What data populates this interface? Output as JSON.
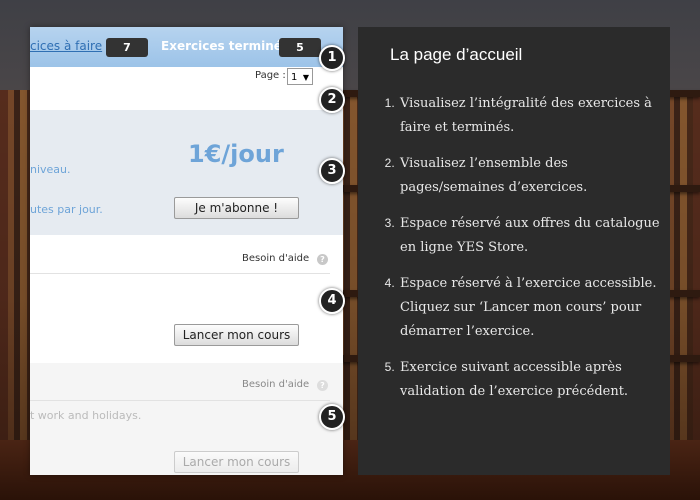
{
  "app": {
    "topbar": {
      "todo_label": "cices à faire",
      "todo_count": "7",
      "done_label": "Exercices terminés",
      "done_count": "5"
    },
    "pagination": {
      "label": "Page :",
      "selected": "1"
    },
    "offer": {
      "price": "1€/jour",
      "line1": "niveau.",
      "line2": "utes par jour.",
      "subscribe_button": "Je m'abonne !"
    },
    "exercise_current": {
      "help_label": "Besoin d'aide",
      "help_icon": "question-icon",
      "start_button": "Lancer mon cours"
    },
    "exercise_next": {
      "help_label": "Besoin d'aide",
      "help_icon": "question-icon",
      "description": "t work and holidays.",
      "start_button": "Lancer mon cours"
    }
  },
  "markers": [
    "1",
    "2",
    "3",
    "4",
    "5"
  ],
  "panel": {
    "title": "La page d’accueil",
    "items": [
      "Visualisez l’intégralité des exercices à faire et terminés.",
      "Visualisez l’ensemble des pages/semaines d’exercices.",
      "Espace réservé aux offres du catalogue en ligne YES Store.",
      "Espace réservé à l’exercice accessible. Cliquez sur ‘Lancer mon cours’ pour démarrer l’exercice.",
      "Exercice suivant accessible après validation de l’exercice précédent."
    ]
  },
  "colors": {
    "topbar": "#9cc3e8",
    "link": "#2f6fb3",
    "accent_price": "#6ea4d8",
    "panel_bg": "#2b2b2b"
  }
}
